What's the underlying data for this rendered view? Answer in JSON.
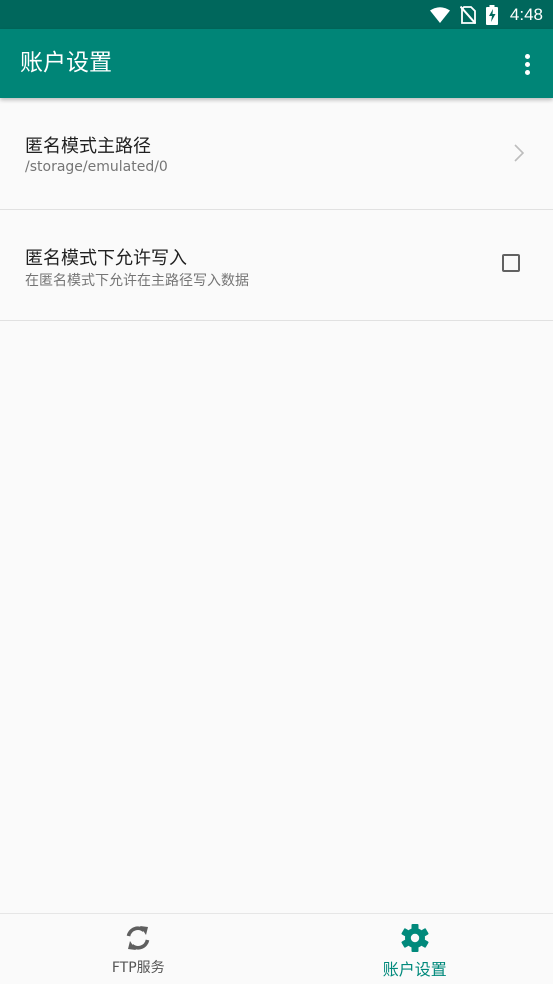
{
  "status_bar": {
    "time": "4:48",
    "icons": [
      "wifi-icon",
      "no-sim-icon",
      "battery-charging-icon"
    ]
  },
  "app_bar": {
    "title": "账户设置",
    "overflow_icon": "more-vert-icon"
  },
  "preferences": [
    {
      "title": "匿名模式主路径",
      "summary": "/storage/emulated/0",
      "widget": "chevron-right-icon"
    },
    {
      "title": "匿名模式下允许写入",
      "summary": "在匿名模式下允许在主路径写入数据",
      "widget": "checkbox",
      "checked": false
    }
  ],
  "bottom_nav": {
    "items": [
      {
        "label": "FTP服务",
        "icon": "sync-icon",
        "active": false
      },
      {
        "label": "账户设置",
        "icon": "gear-icon",
        "active": true
      }
    ]
  },
  "colors": {
    "status_bar": "#00675c",
    "app_bar": "#008577",
    "accent": "#00897b",
    "background": "#fafafa"
  }
}
